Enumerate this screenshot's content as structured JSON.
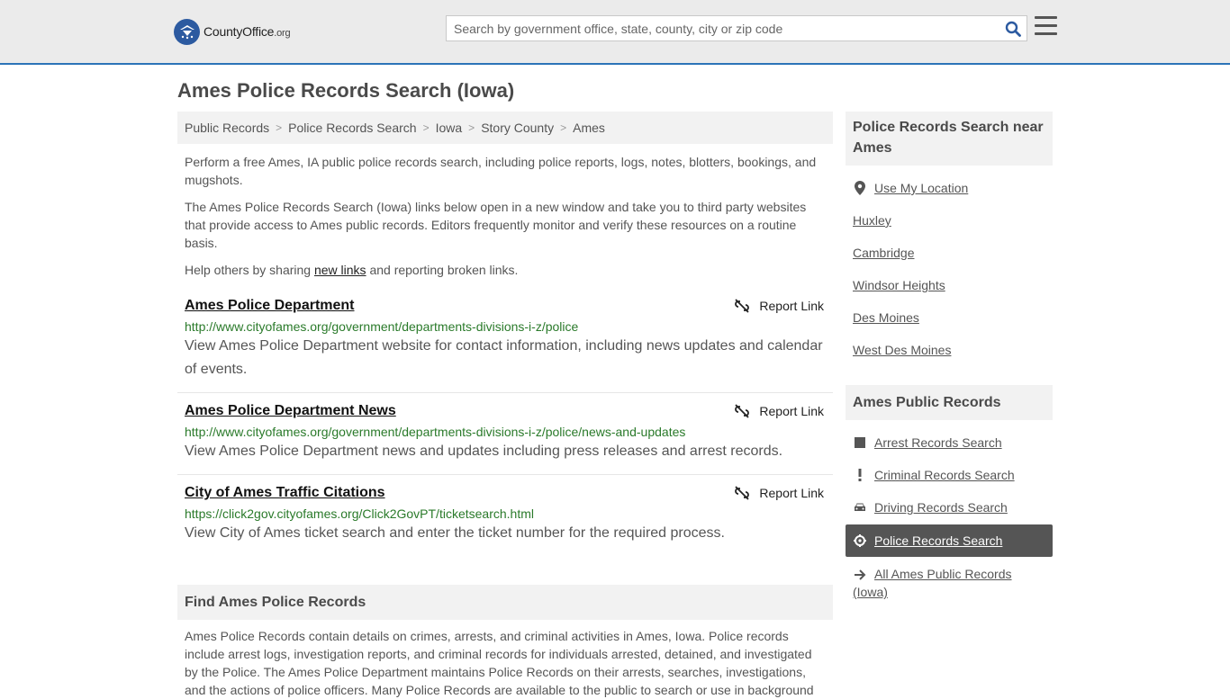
{
  "header": {
    "logo_main": "CountyOffice",
    "logo_suffix": ".org",
    "search_placeholder": "Search by government office, state, county, city or zip code"
  },
  "page_title": "Ames Police Records Search (Iowa)",
  "breadcrumb": [
    "Public Records",
    "Police Records Search",
    "Iowa",
    "Story County",
    "Ames"
  ],
  "intro": {
    "p1": "Perform a free Ames, IA public police records search, including police reports, logs, notes, blotters, bookings, and mugshots.",
    "p2": "The Ames Police Records Search (Iowa) links below open in a new window and take you to third party websites that provide access to Ames public records. Editors frequently monitor and verify these resources on a routine basis.",
    "p3_before": "Help others by sharing ",
    "p3_link": "new links",
    "p3_after": " and reporting broken links."
  },
  "report_label": "Report Link",
  "results": [
    {
      "title": "Ames Police Department",
      "url": "http://www.cityofames.org/government/departments-divisions-i-z/police",
      "desc": "View Ames Police Department website for contact information, including news updates and calendar of events."
    },
    {
      "title": "Ames Police Department News",
      "url": "http://www.cityofames.org/government/departments-divisions-i-z/police/news-and-updates",
      "desc": "View Ames Police Department news and updates including press releases and arrest records."
    },
    {
      "title": "City of Ames Traffic Citations",
      "url": "https://click2gov.cityofames.org/Click2GovPT/ticketsearch.html",
      "desc": "View City of Ames ticket search and enter the ticket number for the required process."
    }
  ],
  "find_section": {
    "title": "Find Ames Police Records",
    "text": "Ames Police Records contain details on crimes, arrests, and criminal activities in Ames, Iowa. Police records include arrest logs, investigation reports, and criminal records for individuals arrested, detained, and investigated by the Police. The Ames Police Department maintains Police Records on their arrests, searches, investigations, and the actions of police officers. Many Police Records are available to the public to search or use in background"
  },
  "sidebar": {
    "near_title": "Police Records Search near Ames",
    "near_items": [
      "Use My Location",
      "Huxley",
      "Cambridge",
      "Windsor Heights",
      "Des Moines",
      "West Des Moines"
    ],
    "public_title": "Ames Public Records",
    "public_items": [
      {
        "label": "Arrest Records Search",
        "icon": "square-icon"
      },
      {
        "label": "Criminal Records Search",
        "icon": "exclamation-icon"
      },
      {
        "label": "Driving Records Search",
        "icon": "car-icon"
      },
      {
        "label": "Police Records Search",
        "icon": "crosshair-icon"
      },
      {
        "label": "All Ames Public Records (Iowa)",
        "icon": "arrow-right-icon"
      }
    ]
  },
  "colors": {
    "accent": "#2c74b8",
    "link_green": "#2a7a2a",
    "active_bg": "#555555"
  }
}
